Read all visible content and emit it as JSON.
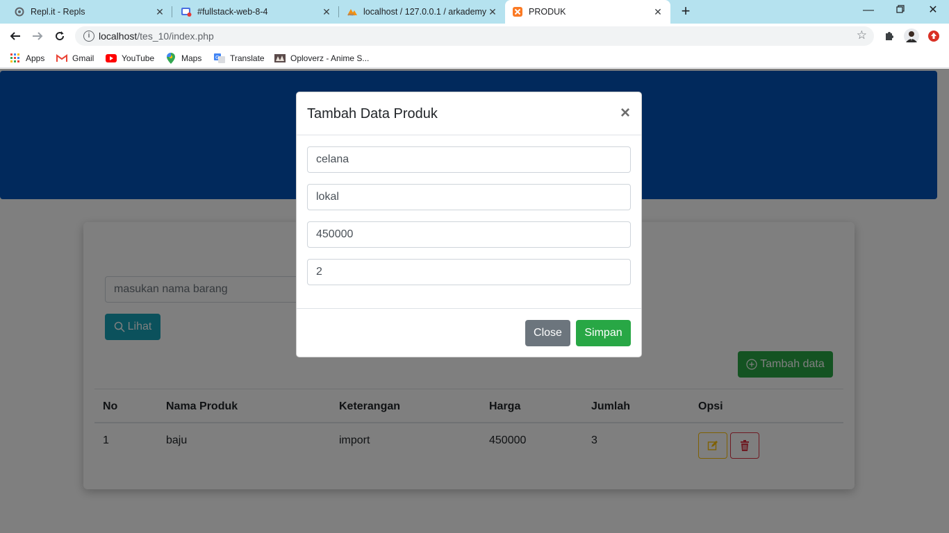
{
  "browser": {
    "tabs": [
      {
        "title": "Repl.it - Repls",
        "icon": "replit-icon"
      },
      {
        "title": "#fullstack-web-8-4",
        "icon": "chat-icon"
      },
      {
        "title": "localhost / 127.0.0.1 / arkademy",
        "icon": "phpmyadmin-icon"
      },
      {
        "title": "PRODUK",
        "icon": "xampp-icon",
        "active": true
      }
    ],
    "url_host": "localhost",
    "url_path": "/tes_10/index.php",
    "bookmarks": [
      {
        "label": "Apps",
        "icon": "apps-grid-icon"
      },
      {
        "label": "Gmail",
        "icon": "gmail-icon"
      },
      {
        "label": "YouTube",
        "icon": "youtube-icon"
      },
      {
        "label": "Maps",
        "icon": "maps-pin-icon"
      },
      {
        "label": "Translate",
        "icon": "translate-icon"
      },
      {
        "label": "Oploverz - Anime S...",
        "icon": "oploverz-icon"
      }
    ]
  },
  "page": {
    "search_placeholder": "masukan nama barang",
    "lihat_label": "Lihat",
    "tambah_label": "Tambah data",
    "table": {
      "headers": [
        "No",
        "Nama Produk",
        "Keterangan",
        "Harga",
        "Jumlah",
        "Opsi"
      ],
      "rows": [
        [
          "1",
          "baju",
          "import",
          "450000",
          "3"
        ]
      ]
    }
  },
  "modal": {
    "title": "Tambah Data Produk",
    "close_symbol": "×",
    "fields": [
      "celana",
      "lokal",
      "450000",
      "2"
    ],
    "close_label": "Close",
    "save_label": "Simpan"
  },
  "colors": {
    "banner": "#0353b8",
    "info": "#17a2b8",
    "success": "#28a745",
    "secondary": "#6c757d",
    "warning": "#ffc107",
    "danger": "#dc3545"
  }
}
